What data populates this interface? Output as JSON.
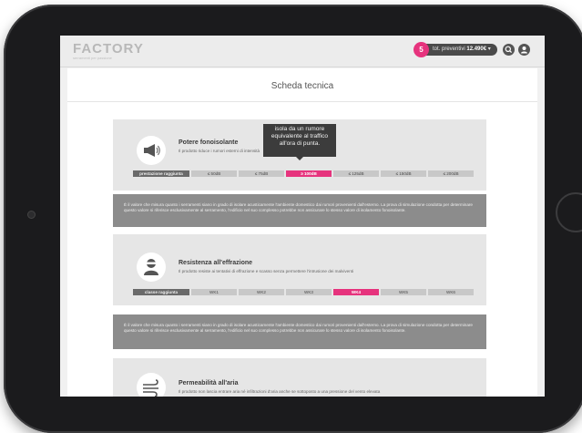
{
  "header": {
    "logo": "FACTORY",
    "logo_tagline": "serramenti per passione",
    "cart_count": "5",
    "cart_label": "tot. preventivi",
    "cart_total": "12.490€",
    "cart_caret": "▾"
  },
  "page": {
    "title": "Scheda tecnica"
  },
  "cards": [
    {
      "title": "Potere fonoisolante",
      "subtitle": "Il prodotto riduce i rumori esterni di intensità",
      "scale_label": "prestazione raggiunta",
      "levels": [
        "≤ 50dB",
        "≤ 75dB",
        "≥ 100dB",
        "≤ 125dB",
        "≤ 150dB",
        "≤ 200dB"
      ],
      "selected": "≥ 100dB",
      "tooltip": "isola da un rumore equivalente al traffico all'ora di punta.",
      "description": "È il valore che misura quanto i serramenti siano in grado di isolare acusticamente l'ambiente domestico dai rumori provenienti dall'esterno. La prova di simulazione condotta per determinare questo valore si riferisce esclusivamente al serramento, l'edificio nel suo complesso potrebbe non assicurare lo stesso valore di isolamento fonoisolante."
    },
    {
      "title": "Resistenza all'effrazione",
      "subtitle": "Il prodotto resiste ai tentativi di effrazione e scasso senza permettere l'intrusione dei malviventi",
      "scale_label": "classe raggiunta",
      "levels": [
        "WK1",
        "WK2",
        "WK3",
        "WK4",
        "WK5",
        "WK6"
      ],
      "selected": "WK4",
      "description": "È il valore che misura quanto i serramenti siano in grado di isolare acusticamente l'ambiente domestico dai rumori provenienti dall'esterno. La prova di simulazione condotta per determinare questo valore si riferisce esclusivamente al serramento, l'edificio nel suo complesso potrebbe non assicurare lo stesso valore di isolamento fonoisolante."
    },
    {
      "title": "Permeabilità all'aria",
      "subtitle": "Il prodotto non lascia entrare aria né infiltrazioni d'aria anche se sottoposto a una pressione del vento elevata"
    }
  ],
  "colors": {
    "accent": "#e6337d",
    "frame": "#1b1b1d",
    "panel": "#e6e6e6",
    "desc": "#8c8c8c"
  },
  "icons": [
    "megaphone-icon",
    "burglar-icon",
    "wind-icon",
    "search-icon",
    "user-icon"
  ]
}
